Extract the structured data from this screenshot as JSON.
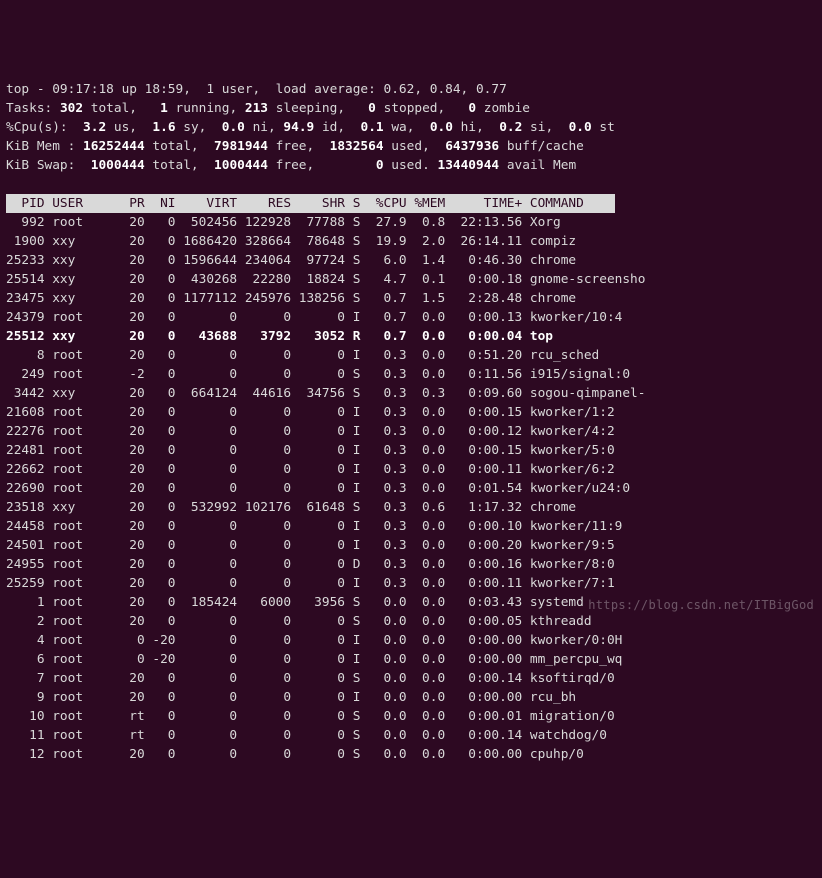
{
  "summary": {
    "line1_a": "top - 09:17:18 up 18:59,  1 user,  load average: 0.62, 0.84, 0.77",
    "tasks": {
      "label": "Tasks:",
      "total": "302",
      "total_lbl": "total,",
      "running": "1",
      "running_lbl": "running,",
      "sleeping": "213",
      "sleeping_lbl": "sleeping,",
      "stopped": "0",
      "stopped_lbl": "stopped,",
      "zombie": "0",
      "zombie_lbl": "zombie"
    },
    "cpu": {
      "label": "%Cpu(s):",
      "us": "3.2",
      "us_lbl": "us,",
      "sy": "1.6",
      "sy_lbl": "sy,",
      "ni": "0.0",
      "ni_lbl": "ni,",
      "id": "94.9",
      "id_lbl": "id,",
      "wa": "0.1",
      "wa_lbl": "wa,",
      "hi": "0.0",
      "hi_lbl": "hi,",
      "si": "0.2",
      "si_lbl": "si,",
      "st": "0.0",
      "st_lbl": "st"
    },
    "mem": {
      "label": "KiB Mem :",
      "total": "16252444",
      "total_lbl": "total,",
      "free": "7981944",
      "free_lbl": "free,",
      "used": "1832564",
      "used_lbl": "used,",
      "buff": "6437936",
      "buff_lbl": "buff/cache"
    },
    "swap": {
      "label": "KiB Swap:",
      "total": "1000444",
      "total_lbl": "total,",
      "free": "1000444",
      "free_lbl": "free,",
      "used": "0",
      "used_lbl": "used.",
      "avail": "13440944",
      "avail_lbl": "avail Mem"
    }
  },
  "columns": "  PID USER      PR  NI    VIRT    RES    SHR S  %CPU %MEM     TIME+ COMMAND    ",
  "rows": [
    {
      "pid": "992",
      "user": "root",
      "pr": "20",
      "ni": "0",
      "virt": "502456",
      "res": "122928",
      "shr": "77788",
      "s": "S",
      "cpu": "27.9",
      "mem": "0.8",
      "time": "22:13.56",
      "cmd": "Xorg",
      "hl": false
    },
    {
      "pid": "1900",
      "user": "xxy",
      "pr": "20",
      "ni": "0",
      "virt": "1686420",
      "res": "328664",
      "shr": "78648",
      "s": "S",
      "cpu": "19.9",
      "mem": "2.0",
      "time": "26:14.11",
      "cmd": "compiz",
      "hl": false
    },
    {
      "pid": "25233",
      "user": "xxy",
      "pr": "20",
      "ni": "0",
      "virt": "1596644",
      "res": "234064",
      "shr": "97724",
      "s": "S",
      "cpu": "6.0",
      "mem": "1.4",
      "time": "0:46.30",
      "cmd": "chrome",
      "hl": false
    },
    {
      "pid": "25514",
      "user": "xxy",
      "pr": "20",
      "ni": "0",
      "virt": "430268",
      "res": "22280",
      "shr": "18824",
      "s": "S",
      "cpu": "4.7",
      "mem": "0.1",
      "time": "0:00.18",
      "cmd": "gnome-screensho",
      "hl": false
    },
    {
      "pid": "23475",
      "user": "xxy",
      "pr": "20",
      "ni": "0",
      "virt": "1177112",
      "res": "245976",
      "shr": "138256",
      "s": "S",
      "cpu": "0.7",
      "mem": "1.5",
      "time": "2:28.48",
      "cmd": "chrome",
      "hl": false
    },
    {
      "pid": "24379",
      "user": "root",
      "pr": "20",
      "ni": "0",
      "virt": "0",
      "res": "0",
      "shr": "0",
      "s": "I",
      "cpu": "0.7",
      "mem": "0.0",
      "time": "0:00.13",
      "cmd": "kworker/10:4",
      "hl": false
    },
    {
      "pid": "25512",
      "user": "xxy",
      "pr": "20",
      "ni": "0",
      "virt": "43688",
      "res": "3792",
      "shr": "3052",
      "s": "R",
      "cpu": "0.7",
      "mem": "0.0",
      "time": "0:00.04",
      "cmd": "top",
      "hl": true
    },
    {
      "pid": "8",
      "user": "root",
      "pr": "20",
      "ni": "0",
      "virt": "0",
      "res": "0",
      "shr": "0",
      "s": "I",
      "cpu": "0.3",
      "mem": "0.0",
      "time": "0:51.20",
      "cmd": "rcu_sched",
      "hl": false
    },
    {
      "pid": "249",
      "user": "root",
      "pr": "-2",
      "ni": "0",
      "virt": "0",
      "res": "0",
      "shr": "0",
      "s": "S",
      "cpu": "0.3",
      "mem": "0.0",
      "time": "0:11.56",
      "cmd": "i915/signal:0",
      "hl": false
    },
    {
      "pid": "3442",
      "user": "xxy",
      "pr": "20",
      "ni": "0",
      "virt": "664124",
      "res": "44616",
      "shr": "34756",
      "s": "S",
      "cpu": "0.3",
      "mem": "0.3",
      "time": "0:09.60",
      "cmd": "sogou-qimpanel-",
      "hl": false
    },
    {
      "pid": "21608",
      "user": "root",
      "pr": "20",
      "ni": "0",
      "virt": "0",
      "res": "0",
      "shr": "0",
      "s": "I",
      "cpu": "0.3",
      "mem": "0.0",
      "time": "0:00.15",
      "cmd": "kworker/1:2",
      "hl": false
    },
    {
      "pid": "22276",
      "user": "root",
      "pr": "20",
      "ni": "0",
      "virt": "0",
      "res": "0",
      "shr": "0",
      "s": "I",
      "cpu": "0.3",
      "mem": "0.0",
      "time": "0:00.12",
      "cmd": "kworker/4:2",
      "hl": false
    },
    {
      "pid": "22481",
      "user": "root",
      "pr": "20",
      "ni": "0",
      "virt": "0",
      "res": "0",
      "shr": "0",
      "s": "I",
      "cpu": "0.3",
      "mem": "0.0",
      "time": "0:00.15",
      "cmd": "kworker/5:0",
      "hl": false
    },
    {
      "pid": "22662",
      "user": "root",
      "pr": "20",
      "ni": "0",
      "virt": "0",
      "res": "0",
      "shr": "0",
      "s": "I",
      "cpu": "0.3",
      "mem": "0.0",
      "time": "0:00.11",
      "cmd": "kworker/6:2",
      "hl": false
    },
    {
      "pid": "22690",
      "user": "root",
      "pr": "20",
      "ni": "0",
      "virt": "0",
      "res": "0",
      "shr": "0",
      "s": "I",
      "cpu": "0.3",
      "mem": "0.0",
      "time": "0:01.54",
      "cmd": "kworker/u24:0",
      "hl": false
    },
    {
      "pid": "23518",
      "user": "xxy",
      "pr": "20",
      "ni": "0",
      "virt": "532992",
      "res": "102176",
      "shr": "61648",
      "s": "S",
      "cpu": "0.3",
      "mem": "0.6",
      "time": "1:17.32",
      "cmd": "chrome",
      "hl": false
    },
    {
      "pid": "24458",
      "user": "root",
      "pr": "20",
      "ni": "0",
      "virt": "0",
      "res": "0",
      "shr": "0",
      "s": "I",
      "cpu": "0.3",
      "mem": "0.0",
      "time": "0:00.10",
      "cmd": "kworker/11:9",
      "hl": false
    },
    {
      "pid": "24501",
      "user": "root",
      "pr": "20",
      "ni": "0",
      "virt": "0",
      "res": "0",
      "shr": "0",
      "s": "I",
      "cpu": "0.3",
      "mem": "0.0",
      "time": "0:00.20",
      "cmd": "kworker/9:5",
      "hl": false
    },
    {
      "pid": "24955",
      "user": "root",
      "pr": "20",
      "ni": "0",
      "virt": "0",
      "res": "0",
      "shr": "0",
      "s": "D",
      "cpu": "0.3",
      "mem": "0.0",
      "time": "0:00.16",
      "cmd": "kworker/8:0",
      "hl": false
    },
    {
      "pid": "25259",
      "user": "root",
      "pr": "20",
      "ni": "0",
      "virt": "0",
      "res": "0",
      "shr": "0",
      "s": "I",
      "cpu": "0.3",
      "mem": "0.0",
      "time": "0:00.11",
      "cmd": "kworker/7:1",
      "hl": false
    },
    {
      "pid": "1",
      "user": "root",
      "pr": "20",
      "ni": "0",
      "virt": "185424",
      "res": "6000",
      "shr": "3956",
      "s": "S",
      "cpu": "0.0",
      "mem": "0.0",
      "time": "0:03.43",
      "cmd": "systemd",
      "hl": false
    },
    {
      "pid": "2",
      "user": "root",
      "pr": "20",
      "ni": "0",
      "virt": "0",
      "res": "0",
      "shr": "0",
      "s": "S",
      "cpu": "0.0",
      "mem": "0.0",
      "time": "0:00.05",
      "cmd": "kthreadd",
      "hl": false
    },
    {
      "pid": "4",
      "user": "root",
      "pr": "0",
      "ni": "-20",
      "virt": "0",
      "res": "0",
      "shr": "0",
      "s": "I",
      "cpu": "0.0",
      "mem": "0.0",
      "time": "0:00.00",
      "cmd": "kworker/0:0H",
      "hl": false
    },
    {
      "pid": "6",
      "user": "root",
      "pr": "0",
      "ni": "-20",
      "virt": "0",
      "res": "0",
      "shr": "0",
      "s": "I",
      "cpu": "0.0",
      "mem": "0.0",
      "time": "0:00.00",
      "cmd": "mm_percpu_wq",
      "hl": false
    },
    {
      "pid": "7",
      "user": "root",
      "pr": "20",
      "ni": "0",
      "virt": "0",
      "res": "0",
      "shr": "0",
      "s": "S",
      "cpu": "0.0",
      "mem": "0.0",
      "time": "0:00.14",
      "cmd": "ksoftirqd/0",
      "hl": false
    },
    {
      "pid": "9",
      "user": "root",
      "pr": "20",
      "ni": "0",
      "virt": "0",
      "res": "0",
      "shr": "0",
      "s": "I",
      "cpu": "0.0",
      "mem": "0.0",
      "time": "0:00.00",
      "cmd": "rcu_bh",
      "hl": false
    },
    {
      "pid": "10",
      "user": "root",
      "pr": "rt",
      "ni": "0",
      "virt": "0",
      "res": "0",
      "shr": "0",
      "s": "S",
      "cpu": "0.0",
      "mem": "0.0",
      "time": "0:00.01",
      "cmd": "migration/0",
      "hl": false
    },
    {
      "pid": "11",
      "user": "root",
      "pr": "rt",
      "ni": "0",
      "virt": "0",
      "res": "0",
      "shr": "0",
      "s": "S",
      "cpu": "0.0",
      "mem": "0.0",
      "time": "0:00.14",
      "cmd": "watchdog/0",
      "hl": false
    },
    {
      "pid": "12",
      "user": "root",
      "pr": "20",
      "ni": "0",
      "virt": "0",
      "res": "0",
      "shr": "0",
      "s": "S",
      "cpu": "0.0",
      "mem": "0.0",
      "time": "0:00.00",
      "cmd": "cpuhp/0",
      "hl": false
    }
  ],
  "watermark": "https://blog.csdn.net/ITBigGod"
}
